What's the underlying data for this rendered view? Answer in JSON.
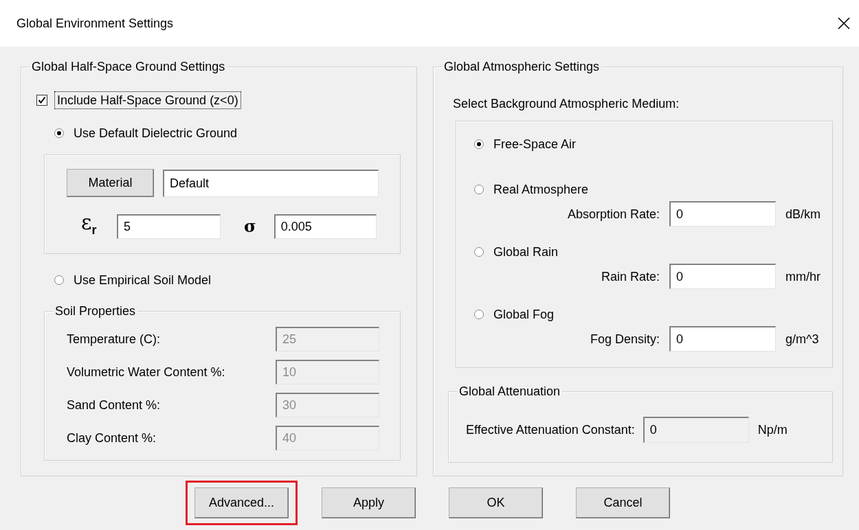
{
  "window": {
    "title": "Global Environment Settings"
  },
  "ground": {
    "title": "Global Half-Space Ground Settings",
    "include": {
      "label": "Include Half-Space Ground (z<0)",
      "checked": true,
      "focused": true
    },
    "default_option": {
      "label": "Use Default Dielectric Ground",
      "selected": true
    },
    "material": {
      "button": "Material",
      "value": "Default"
    },
    "permittivity": {
      "symbol": "ε$_{r}$",
      "value": "5"
    },
    "conductivity": {
      "symbol": "σ",
      "value": "0.005"
    },
    "empirical_option": {
      "label": "Use Empirical Soil Model",
      "selected": false
    },
    "soil": {
      "title": "Soil Properties",
      "disabled": true,
      "fields": [
        {
          "label": "Temperature (C):",
          "value": "25"
        },
        {
          "label": "Volumetric Water Content %:",
          "value": "10"
        },
        {
          "label": "Sand Content %:",
          "value": "30"
        },
        {
          "label": "Clay Content %:",
          "value": "40"
        }
      ]
    }
  },
  "atmosphere": {
    "title": "Global Atmospheric Settings",
    "prompt": "Select Background Atmospheric Medium:",
    "media": [
      {
        "label": "Free-Space Air",
        "selected": true
      },
      {
        "label": "Real Atmosphere",
        "selected": false,
        "field": {
          "label": "Absorption Rate:",
          "value": "0",
          "unit": "dB/km"
        }
      },
      {
        "label": "Global Rain",
        "selected": false,
        "field": {
          "label": "Rain Rate:",
          "value": "0",
          "unit": "mm/hr"
        }
      },
      {
        "label": "Global Fog",
        "selected": false,
        "field": {
          "label": "Fog Density:",
          "value": "0",
          "unit": "g/m^3"
        }
      }
    ],
    "attenuation": {
      "title": "Global Attenuation",
      "label": "Effective Attenuation Constant:",
      "value": "0",
      "unit": "Np/m",
      "disabled": true
    }
  },
  "buttons": [
    {
      "label": "Advanced...",
      "highlighted": true
    },
    {
      "label": "Apply",
      "highlighted": false
    },
    {
      "label": "OK",
      "highlighted": false
    },
    {
      "label": "Cancel",
      "highlighted": false
    }
  ]
}
